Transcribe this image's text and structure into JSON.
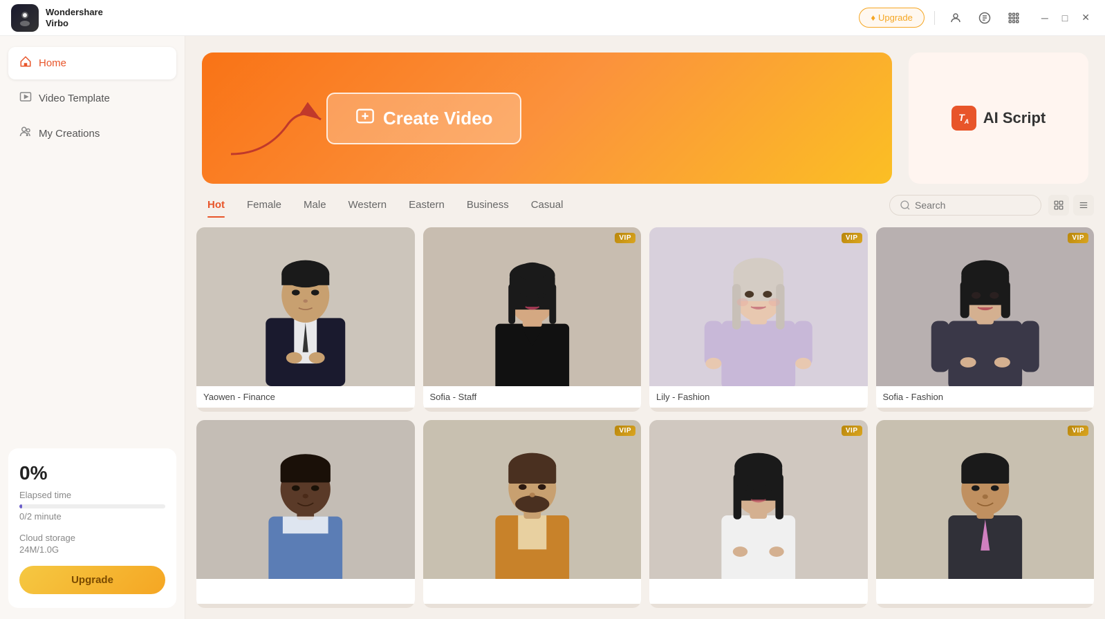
{
  "titleBar": {
    "appName": "Wondershare\nVirbo",
    "upgradeBtn": "Upgrade",
    "icons": [
      "user",
      "chat",
      "grid",
      "minimize",
      "maximize",
      "close"
    ]
  },
  "sidebar": {
    "navItems": [
      {
        "id": "home",
        "label": "Home",
        "icon": "🏠",
        "active": true
      },
      {
        "id": "video-template",
        "label": "Video Template",
        "icon": "🎬",
        "active": false
      },
      {
        "id": "my-creations",
        "label": "My Creations",
        "icon": "👤",
        "active": false
      }
    ],
    "stats": {
      "percentLabel": "0%",
      "elapsedLabel": "Elapsed time",
      "minutes": "0/2 minute",
      "storageLabel": "Cloud storage",
      "storageValue": "24M/1.0G",
      "upgradeBtn": "Upgrade"
    }
  },
  "hero": {
    "createVideoBtn": "Create Video"
  },
  "aiScript": {
    "label": "AI Script"
  },
  "tabs": {
    "items": [
      {
        "id": "hot",
        "label": "Hot",
        "active": true
      },
      {
        "id": "female",
        "label": "Female",
        "active": false
      },
      {
        "id": "male",
        "label": "Male",
        "active": false
      },
      {
        "id": "western",
        "label": "Western",
        "active": false
      },
      {
        "id": "eastern",
        "label": "Eastern",
        "active": false
      },
      {
        "id": "business",
        "label": "Business",
        "active": false
      },
      {
        "id": "casual",
        "label": "Casual",
        "active": false
      }
    ],
    "searchPlaceholder": "Search"
  },
  "avatars": [
    {
      "name": "Yaowen - Finance",
      "vip": false,
      "bg": "#ccc5bb",
      "skin": "#c8a882",
      "hair": "#1a1a1a",
      "outfit": "#1a1a2e"
    },
    {
      "name": "Sofia - Staff",
      "vip": true,
      "bg": "#c8bdb0",
      "skin": "#d4a882",
      "hair": "#1a1a1a",
      "outfit": "#1a1a1a"
    },
    {
      "name": "Lily - Fashion",
      "vip": true,
      "bg": "#d8d0dc",
      "skin": "#e8c8b0",
      "hair": "#c8c0b0",
      "outfit": "#d4c8e0"
    },
    {
      "name": "Sofia - Fashion",
      "vip": true,
      "bg": "#c0b8b8",
      "skin": "#d4b090",
      "hair": "#1a1a1a",
      "outfit": "#404050"
    },
    {
      "name": "",
      "vip": false,
      "bg": "#c4bdb5",
      "skin": "#6b4c38",
      "hair": "#1a1008",
      "outfit": "#5b9bd5"
    },
    {
      "name": "",
      "vip": true,
      "bg": "#c8c0b0",
      "skin": "#c8a070",
      "hair": "#4a3020",
      "outfit": "#c8822a"
    },
    {
      "name": "",
      "vip": true,
      "bg": "#d0c8c0",
      "skin": "#d4b090",
      "hair": "#1a1a1a",
      "outfit": "#f0f0f0"
    },
    {
      "name": "",
      "vip": true,
      "bg": "#c8c0b0",
      "skin": "#c09060",
      "hair": "#1a1a1a",
      "outfit": "#c0a0c0"
    }
  ]
}
